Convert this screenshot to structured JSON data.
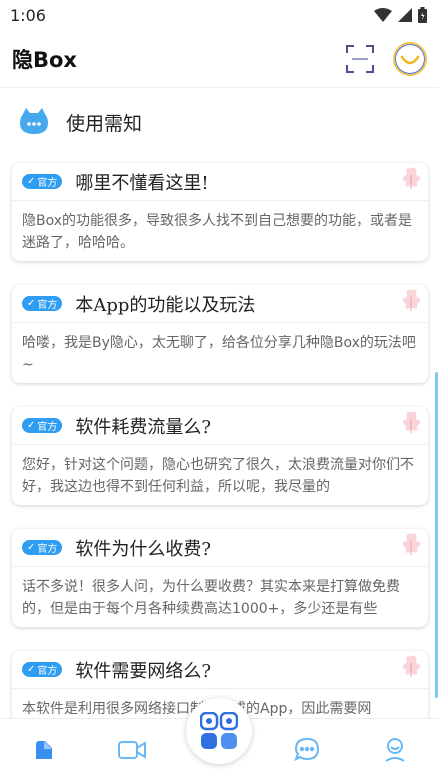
{
  "status_bar": {
    "time": "1:06"
  },
  "header": {
    "title": "隐Box"
  },
  "notice": {
    "label": "使用需知"
  },
  "badge_label": "官方",
  "cards": [
    {
      "title": "哪里不懂看这里!",
      "body": "隐Box的功能很多，导致很多人找不到自己想要的功能，或者是迷路了，哈哈哈。"
    },
    {
      "title": "本App的功能以及玩法",
      "body": "哈喽，我是By隐心，太无聊了，给各位分享几种隐Box的玩法吧~"
    },
    {
      "title": "软件耗费流量么?",
      "body": "您好，针对这个问题，隐心也研究了很久，太浪费流量对你们不好，我这边也得不到任何利益，所以呢，我尽量的"
    },
    {
      "title": "软件为什么收费?",
      "body": "话不多说！很多人问，为什么要收费？其实本来是打算做免费的，但是由于每个月各种续费高达1000+，多少还是有些"
    },
    {
      "title": "软件需要网络么?",
      "body": "本软件是利用很多网络接口制作而成的App，因此需要网"
    }
  ],
  "nav": {
    "items": [
      "home-icon",
      "video-icon",
      "apps-icon",
      "chat-icon",
      "profile-icon"
    ]
  },
  "colors": {
    "accent": "#2f9df2",
    "scroll": "#7fc8f0"
  }
}
